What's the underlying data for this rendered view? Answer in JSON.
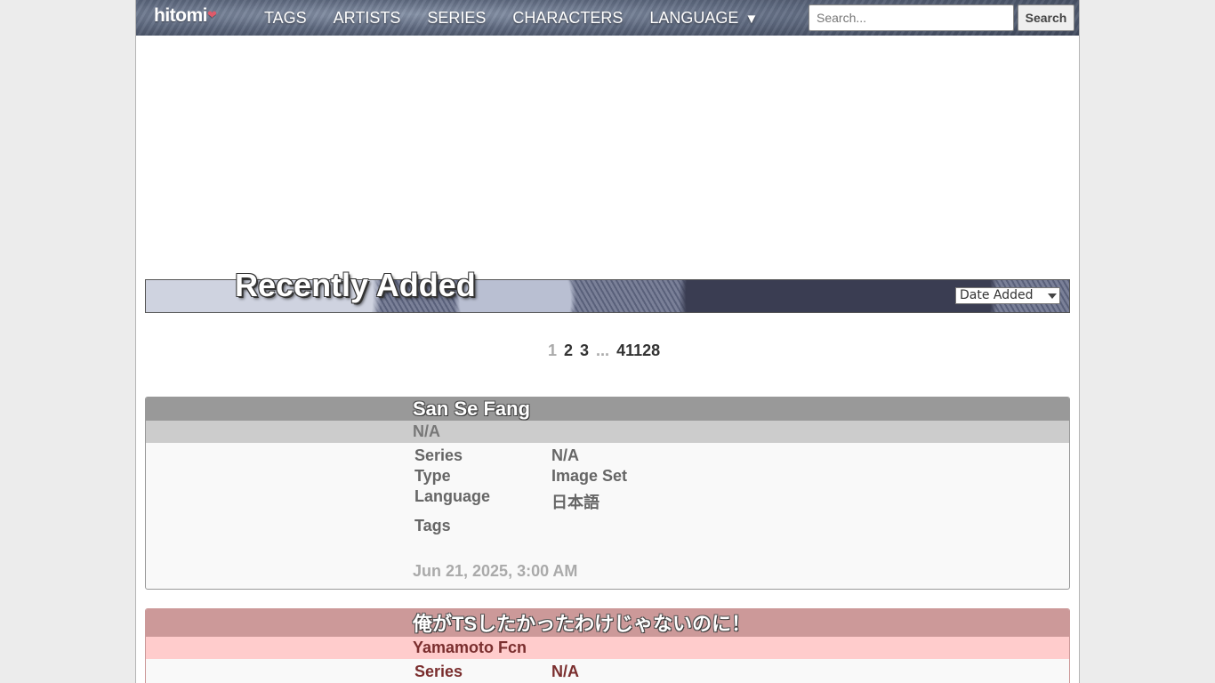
{
  "header": {
    "logo_text": "hitomi",
    "nav": [
      "TAGS",
      "ARTISTS",
      "SERIES",
      "CHARACTERS",
      "LANGUAGE"
    ],
    "language_arrow": "▼",
    "search_placeholder": "Search...",
    "search_button": "Search"
  },
  "banner": {
    "title": "Recently Added",
    "sort_value": "Date Added"
  },
  "pagination": {
    "current": "1",
    "pages": [
      "2",
      "3"
    ],
    "ellipsis": "...",
    "last": "41128"
  },
  "galleries": [
    {
      "title": "San Se Fang",
      "artist": "N/A",
      "fields": [
        {
          "label": "Series",
          "value": "N/A"
        },
        {
          "label": "Type",
          "value": "Image Set"
        },
        {
          "label": "Language",
          "value": "日本語"
        },
        {
          "label": "Tags",
          "value": ""
        }
      ],
      "date": "Jun 21, 2025, 3:00 AM"
    },
    {
      "title": "俺がTSしたかったわけじゃないのに！",
      "artist": "Yamamoto Fcn",
      "fields": [
        {
          "label": "Series",
          "value": "N/A"
        }
      ]
    }
  ]
}
